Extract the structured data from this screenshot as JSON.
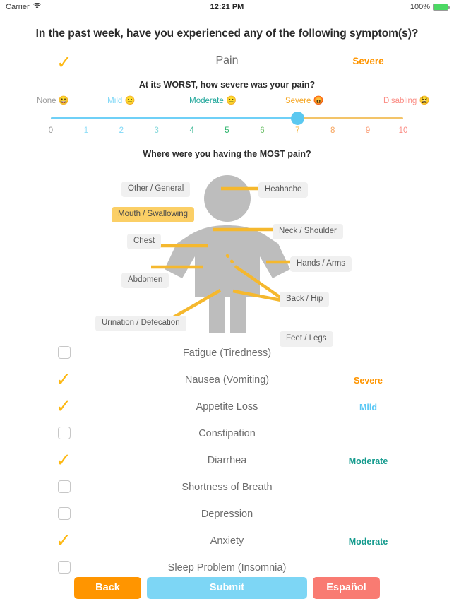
{
  "status_bar": {
    "carrier": "Carrier",
    "wifi_icon": "wifi-icon",
    "time": "12:21 PM",
    "battery_percent": "100%",
    "battery_icon": "battery-full-icon"
  },
  "question": {
    "title": "In the past week, have you experienced any of the following symptom(s)?"
  },
  "pain": {
    "checked_icon": "checkmark-icon",
    "label": "Pain",
    "severity": "Severe",
    "severity_color": "#FF9500",
    "sub_question": "At its WORST, how severe was your pain?",
    "slider": {
      "value": 7,
      "min": 0,
      "max": 10,
      "fill_color": "#6FD0F7",
      "rest_color": "#F3C469",
      "thumb_color": "#5BC8F0",
      "anchors": [
        {
          "label": "None",
          "emoji": "😀",
          "color": "#9b9b9b",
          "pos": 0
        },
        {
          "label": "Mild",
          "emoji": "😐",
          "color": "#7FD8F7",
          "pos": 2
        },
        {
          "label": "Moderate",
          "emoji": "😐",
          "color": "#21A79B",
          "pos": 4.6
        },
        {
          "label": "Severe",
          "emoji": "😡",
          "color": "#F5A623",
          "pos": 7.2
        },
        {
          "label": "Disabling",
          "emoji": "😫",
          "color": "#FB8E86",
          "pos": 10
        }
      ],
      "ticks": [
        {
          "value": "0",
          "color": "#9b9b9b"
        },
        {
          "value": "1",
          "color": "#8FDEF8"
        },
        {
          "value": "2",
          "color": "#7FD8F7"
        },
        {
          "value": "3",
          "color": "#86D9DC"
        },
        {
          "value": "4",
          "color": "#4DBE9E"
        },
        {
          "value": "5",
          "color": "#2FB56E"
        },
        {
          "value": "6",
          "color": "#6FC16B"
        },
        {
          "value": "7",
          "color": "#F5B43C"
        },
        {
          "value": "8",
          "color": "#F7A55E"
        },
        {
          "value": "9",
          "color": "#FBA37E"
        },
        {
          "value": "10",
          "color": "#FB8E86"
        }
      ]
    }
  },
  "body_map": {
    "question": "Where were you having the MOST pain?",
    "labels": [
      {
        "name": "other-general",
        "text": "Other / General",
        "selected": false
      },
      {
        "name": "mouth-swallowing",
        "text": "Mouth / Swallowing",
        "selected": true
      },
      {
        "name": "chest",
        "text": "Chest",
        "selected": false
      },
      {
        "name": "abdomen",
        "text": "Abdomen",
        "selected": false
      },
      {
        "name": "urination-defecation",
        "text": "Urination / Defecation",
        "selected": false
      },
      {
        "name": "headache",
        "text": "Heahache",
        "selected": false
      },
      {
        "name": "neck-shoulder",
        "text": "Neck / Shoulder",
        "selected": false
      },
      {
        "name": "hands-arms",
        "text": "Hands / Arms",
        "selected": false
      },
      {
        "name": "back-hip",
        "text": "Back / Hip",
        "selected": false
      },
      {
        "name": "feet-legs",
        "text": "Feet / Legs",
        "selected": false
      }
    ]
  },
  "symptoms": [
    {
      "name": "fatigue",
      "label": "Fatigue (Tiredness)",
      "checked": false,
      "severity": "",
      "color": ""
    },
    {
      "name": "nausea",
      "label": "Nausea (Vomiting)",
      "checked": true,
      "severity": "Severe",
      "color": "#FF9500"
    },
    {
      "name": "appetite-loss",
      "label": "Appetite Loss",
      "checked": true,
      "severity": "Mild",
      "color": "#5BC8F5"
    },
    {
      "name": "constipation",
      "label": "Constipation",
      "checked": false,
      "severity": "",
      "color": ""
    },
    {
      "name": "diarrhea",
      "label": "Diarrhea",
      "checked": true,
      "severity": "Moderate",
      "color": "#159B8E"
    },
    {
      "name": "shortness-of-breath",
      "label": "Shortness of Breath",
      "checked": false,
      "severity": "",
      "color": ""
    },
    {
      "name": "depression",
      "label": "Depression",
      "checked": false,
      "severity": "",
      "color": ""
    },
    {
      "name": "anxiety",
      "label": "Anxiety",
      "checked": true,
      "severity": "Moderate",
      "color": "#159B8E"
    },
    {
      "name": "sleep-problem",
      "label": "Sleep Problem (Insomnia)",
      "checked": false,
      "severity": "",
      "color": ""
    }
  ],
  "footer": {
    "back_label": "Back",
    "submit_label": "Submit",
    "language_label": "Español",
    "back_color": "#FF9500",
    "submit_color": "#7DD6F5",
    "language_color": "#F97B72"
  }
}
